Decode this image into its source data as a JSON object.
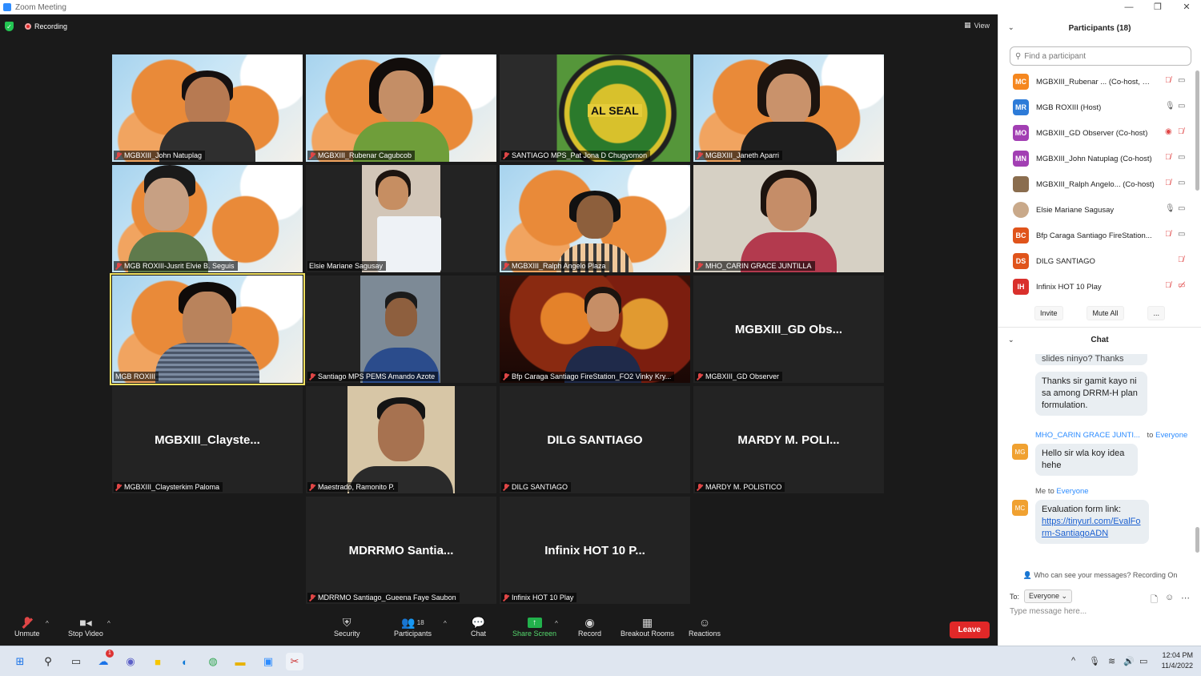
{
  "window": {
    "title": "Zoom Meeting"
  },
  "meeting": {
    "recording_label": "Recording",
    "view_label": "View"
  },
  "tiles": [
    {
      "label": "MGBXIII_John Natuplag",
      "muted": true
    },
    {
      "label": "MGBXIII_Rubenar Cagubcob",
      "muted": true
    },
    {
      "label": "SANTIAGO MPS_Pat Jona D Chugyomon",
      "muted": true,
      "seal_text": "AL SEAL"
    },
    {
      "label": "MGBXIII_Janeth Aparri",
      "muted": true
    },
    {
      "label": "MGB ROXIII-Jusrit Elvie B. Seguis",
      "muted": true
    },
    {
      "label": "Elsie Mariane Sagusay",
      "muted": false
    },
    {
      "label": "MGBXIII_Ralph Angelo Plaza",
      "muted": true
    },
    {
      "label": "MHO_CARIN GRACE JUNTILLA",
      "muted": true
    },
    {
      "label": "MGB ROXIII",
      "muted": false,
      "active": true
    },
    {
      "label": "Santiago MPS PEMS Amando Azote",
      "muted": true
    },
    {
      "label": "Bfp Caraga Santiago FireStation_FO2 Vinky Kry...",
      "muted": true
    },
    {
      "label": "MGBXIII_GD Observer",
      "muted": true,
      "bigname": "MGBXIII_GD Obs..."
    },
    {
      "label": "MGBXIII_Claysterkim Paloma",
      "muted": true,
      "bigname": "MGBXIII_Clayste..."
    },
    {
      "label": "Maestrado, Ramonito P.",
      "muted": true
    },
    {
      "label": "DILG SANTIAGO",
      "muted": true,
      "bigname": "DILG SANTIAGO"
    },
    {
      "label": "MARDY M. POLISTICO",
      "muted": true,
      "bigname": "MARDY M. POLI..."
    },
    {
      "label": "MDRRMO Santiago_Gueena Faye Saubon",
      "muted": true,
      "bigname": "MDRRMO Santia..."
    },
    {
      "label": "Infinix HOT 10 Play",
      "muted": true,
      "bigname": "Infinix HOT 10 P..."
    }
  ],
  "toolbar": {
    "unmute": "Unmute",
    "stop_video": "Stop Video",
    "security": "Security",
    "participants": "Participants",
    "participants_count": "18",
    "chat": "Chat",
    "share_screen": "Share Screen",
    "record": "Record",
    "breakout_rooms": "Breakout Rooms",
    "reactions": "Reactions",
    "leave": "Leave"
  },
  "participants_panel": {
    "title": "Participants (18)",
    "search_placeholder": "Find a participant",
    "list": [
      {
        "initials": "MC",
        "color": "#f5871f",
        "name": "MGBXIII_Rubenar ... (Co-host, me)"
      },
      {
        "initials": "MR",
        "color": "#2d7bd8",
        "name": "MGB ROXIII (Host)"
      },
      {
        "initials": "MO",
        "color": "#a23fb3",
        "name": "MGBXIII_GD Observer (Co-host)"
      },
      {
        "initials": "MN",
        "color": "#a23fb3",
        "name": "MGBXIII_John Natuplag (Co-host)"
      },
      {
        "initials": "",
        "color": "#8a6d4e",
        "name": "MGBXIII_Ralph Angelo... (Co-host)"
      },
      {
        "initials": "",
        "color": "#c9a98a",
        "name": "Elsie Mariane Sagusay"
      },
      {
        "initials": "BC",
        "color": "#e0541b",
        "name": "Bfp Caraga Santiago FireStation..."
      },
      {
        "initials": "DS",
        "color": "#e0541b",
        "name": "DILG SANTIAGO"
      },
      {
        "initials": "IH",
        "color": "#d9302c",
        "name": "Infinix HOT 10 Play"
      }
    ],
    "invite": "Invite",
    "mute_all": "Mute All",
    "more": "..."
  },
  "chat": {
    "title": "Chat",
    "partial_message": "slides ninyo? Thanks",
    "message1": "Thanks sir gamit kayo ni sa among DRRM-H plan formulation.",
    "sender2": "MHO_CARIN GRACE JUNTI...",
    "to_word": "to",
    "everyone": "Everyone",
    "avatar2": "MG",
    "message2": "Hello sir wla koy idea hehe",
    "me_label": "Me",
    "avatar3": "MC",
    "message3_prefix": "Evaluation form link:",
    "message3_link": "https://tinyurl.com/EvalForm-SantiagoADN",
    "who_can_see": "Who can see your messages? Recording On",
    "to_label": "To:",
    "to_value": "Everyone",
    "input_placeholder": "Type message here..."
  },
  "taskbar": {
    "time": "12:04 PM",
    "date": "11/4/2022",
    "badge": "1"
  }
}
